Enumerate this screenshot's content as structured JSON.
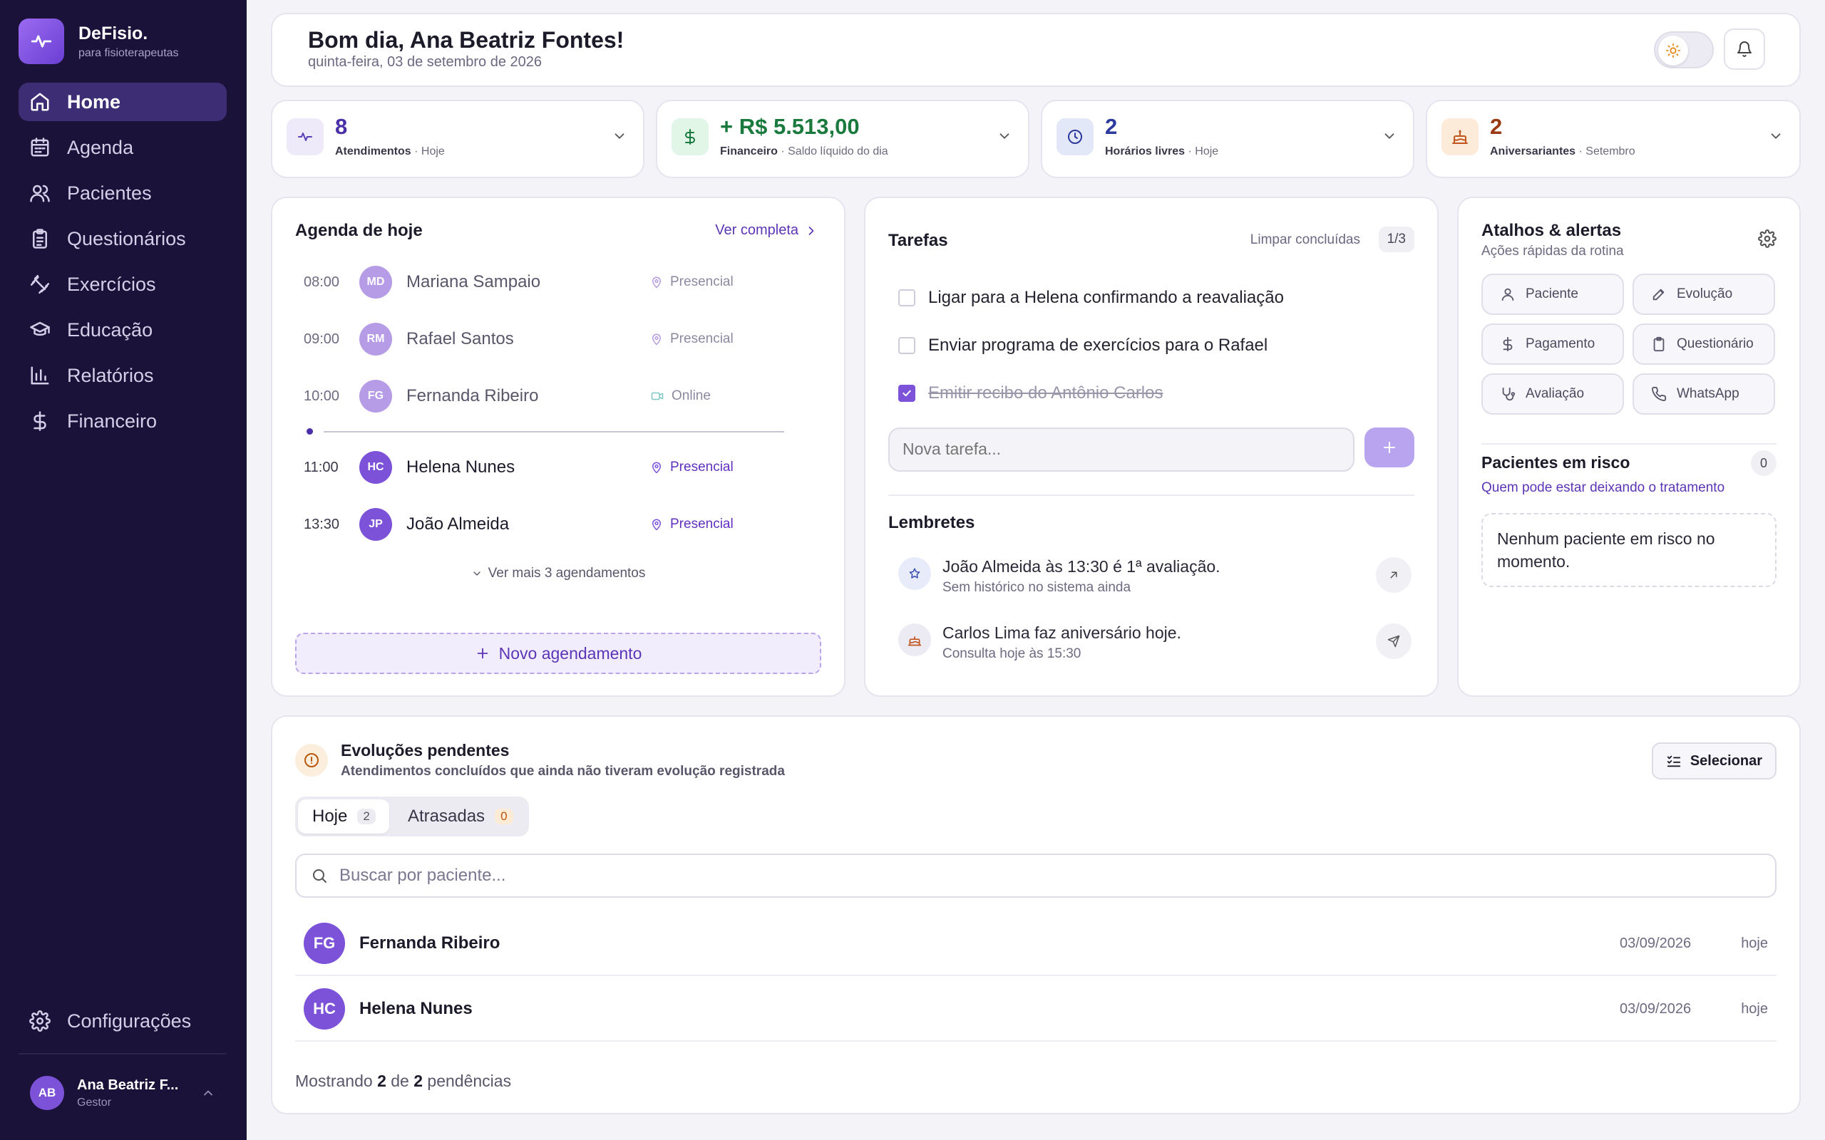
{
  "brand": {
    "name": "DeFisio.",
    "tagline": "para fisioterapeutas"
  },
  "nav": [
    {
      "label": "Home",
      "icon": "home-icon",
      "active": true
    },
    {
      "label": "Agenda",
      "icon": "calendar-icon"
    },
    {
      "label": "Pacientes",
      "icon": "users-icon"
    },
    {
      "label": "Questionários",
      "icon": "clipboard-icon"
    },
    {
      "label": "Exercícios",
      "icon": "dumbbell-icon"
    },
    {
      "label": "Educação",
      "icon": "graduation-cap-icon"
    },
    {
      "label": "Relatórios",
      "icon": "bar-chart-icon"
    },
    {
      "label": "Financeiro",
      "icon": "dollar-icon"
    }
  ],
  "settings_label": "Configurações",
  "user": {
    "initials": "AB",
    "name": "Ana Beatriz F...",
    "role": "Gestor"
  },
  "header": {
    "greeting": "Bom dia, Ana Beatriz Fontes!",
    "date": "quinta-feira, 03 de setembro de 2026"
  },
  "stats": [
    {
      "value": "8",
      "label": "Atendimentos",
      "sub": " · Hoje",
      "icon": "activity-icon",
      "color": "#4a2fa8"
    },
    {
      "value": "+ R$ 5.513,00",
      "label": "Financeiro",
      "sub": " · Saldo líquido do dia",
      "icon": "dollar-icon",
      "color": "#1a7a3e"
    },
    {
      "value": "2",
      "label": "Horários livres",
      "sub": " · Hoje",
      "icon": "clock-icon",
      "color": "#2b3a9c"
    },
    {
      "value": "2",
      "label": "Aniversariantes",
      "sub": " · Setembro",
      "icon": "cake-icon",
      "color": "#9a3a12"
    }
  ],
  "agenda": {
    "title": "Agenda de hoje",
    "link": "Ver completa",
    "items": [
      {
        "time": "08:00",
        "initials": "MD",
        "name": "Mariana Sampaio",
        "mode": "Presencial"
      },
      {
        "time": "09:00",
        "initials": "RM",
        "name": "Rafael Santos",
        "mode": "Presencial"
      },
      {
        "time": "10:00",
        "initials": "FG",
        "name": "Fernanda Ribeiro",
        "mode": "Online"
      },
      {
        "time": "11:00",
        "initials": "HC",
        "name": "Helena Nunes",
        "mode": "Presencial"
      },
      {
        "time": "13:30",
        "initials": "JP",
        "name": "João Almeida",
        "mode": "Presencial"
      }
    ],
    "more": "Ver mais 3 agendamentos",
    "new_button": "Novo agendamento"
  },
  "tasks": {
    "title": "Tarefas",
    "clear": "Limpar concluídas",
    "count": "1/3",
    "items": [
      {
        "text": "Ligar para a Helena confirmando a reavaliação",
        "done": false
      },
      {
        "text": "Enviar programa de exercícios para o Rafael",
        "done": false
      },
      {
        "text": "Emitir recibo do Antônio Carlos",
        "done": true
      }
    ],
    "placeholder": "Nova tarefa..."
  },
  "reminders": {
    "title": "Lembretes",
    "items": [
      {
        "text": "João Almeida às 13:30 é 1ª avaliação.",
        "sub": "Sem histórico no sistema ainda"
      },
      {
        "text": "Carlos Lima faz aniversário hoje.",
        "sub": "Consulta hoje às 15:30"
      }
    ]
  },
  "shortcuts": {
    "title": "Atalhos & alertas",
    "subtitle": "Ações rápidas da rotina",
    "chips": [
      "Paciente",
      "Evolução",
      "Pagamento",
      "Questionário",
      "Avaliação",
      "WhatsApp"
    ]
  },
  "risk": {
    "title": "Pacientes em risco",
    "count": "0",
    "subtitle": "Quem pode estar deixando o tratamento",
    "empty": "Nenhum paciente em risco no momento."
  },
  "pending": {
    "title": "Evoluções pendentes",
    "subtitle": "Atendimentos concluídos que ainda não tiveram evolução registrada",
    "select": "Selecionar",
    "tabs": [
      {
        "label": "Hoje",
        "count": "2"
      },
      {
        "label": "Atrasadas",
        "count": "0"
      }
    ],
    "search_placeholder": "Buscar por paciente...",
    "rows": [
      {
        "initials": "FG",
        "name": "Fernanda Ribeiro",
        "date": "03/09/2026",
        "when": "hoje"
      },
      {
        "initials": "HC",
        "name": "Helena Nunes",
        "date": "03/09/2026",
        "when": "hoje"
      }
    ],
    "footer": {
      "prefix": "Mostrando ",
      "shown": "2",
      "mid": " de ",
      "total": "2",
      "suffix": " pendências"
    }
  }
}
